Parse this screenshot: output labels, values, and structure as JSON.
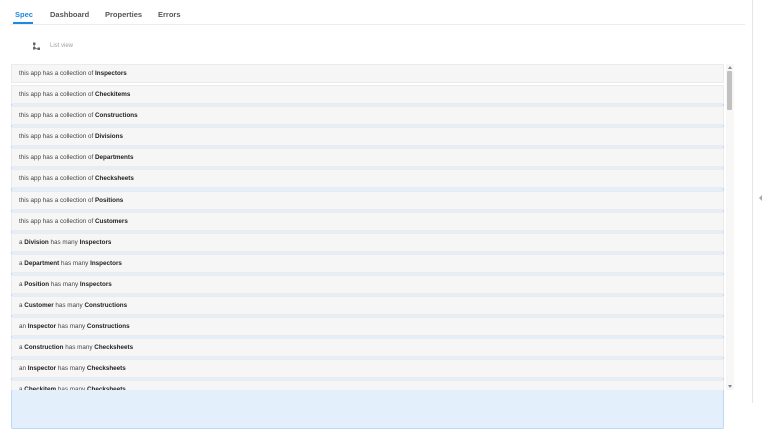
{
  "tabs": [
    {
      "label": "Spec",
      "active": true
    },
    {
      "label": "Dashboard",
      "active": false
    },
    {
      "label": "Properties",
      "active": false
    },
    {
      "label": "Errors",
      "active": false
    }
  ],
  "toolbar": {
    "list_icon": "list-icon",
    "graph_icon": "graph-icon",
    "view_label": "List view"
  },
  "spec_rows": [
    [
      {
        "t": "this app has a collection of "
      },
      {
        "t": "Inspectors",
        "b": true
      }
    ],
    [
      {
        "t": "this app has a collection of "
      },
      {
        "t": "Checkitems",
        "b": true
      }
    ],
    [
      {
        "t": "this app has a collection of "
      },
      {
        "t": "Constructions",
        "b": true
      }
    ],
    [
      {
        "t": "this app has a collection of "
      },
      {
        "t": "Divisions",
        "b": true
      }
    ],
    [
      {
        "t": "this app has a collection of "
      },
      {
        "t": "Departments",
        "b": true
      }
    ],
    [
      {
        "t": "this app has a collection of "
      },
      {
        "t": "Checksheets",
        "b": true
      }
    ],
    [
      {
        "t": "this app has a collection of "
      },
      {
        "t": "Positions",
        "b": true
      }
    ],
    [
      {
        "t": "this app has a collection of "
      },
      {
        "t": "Customers",
        "b": true
      }
    ],
    [
      {
        "t": "a "
      },
      {
        "t": "Division",
        "b": true
      },
      {
        "t": " has many "
      },
      {
        "t": "Inspectors",
        "b": true
      }
    ],
    [
      {
        "t": "a "
      },
      {
        "t": "Department",
        "b": true
      },
      {
        "t": " has many "
      },
      {
        "t": "Inspectors",
        "b": true
      }
    ],
    [
      {
        "t": "a "
      },
      {
        "t": "Position",
        "b": true
      },
      {
        "t": " has many "
      },
      {
        "t": "Inspectors",
        "b": true
      }
    ],
    [
      {
        "t": "a "
      },
      {
        "t": "Customer",
        "b": true
      },
      {
        "t": " has many "
      },
      {
        "t": "Constructions",
        "b": true
      }
    ],
    [
      {
        "t": "an "
      },
      {
        "t": "Inspector",
        "b": true
      },
      {
        "t": " has many "
      },
      {
        "t": "Constructions",
        "b": true
      }
    ],
    [
      {
        "t": "a "
      },
      {
        "t": "Construction",
        "b": true
      },
      {
        "t": " has many "
      },
      {
        "t": "Checksheets",
        "b": true
      }
    ],
    [
      {
        "t": "an "
      },
      {
        "t": "Inspector",
        "b": true
      },
      {
        "t": " has many "
      },
      {
        "t": "Checksheets",
        "b": true
      }
    ],
    [
      {
        "t": "a "
      },
      {
        "t": "Checkitem",
        "b": true
      },
      {
        "t": " has many "
      },
      {
        "t": "Checksheets",
        "b": true
      }
    ]
  ],
  "colors": {
    "accent": "#1e88e5"
  }
}
